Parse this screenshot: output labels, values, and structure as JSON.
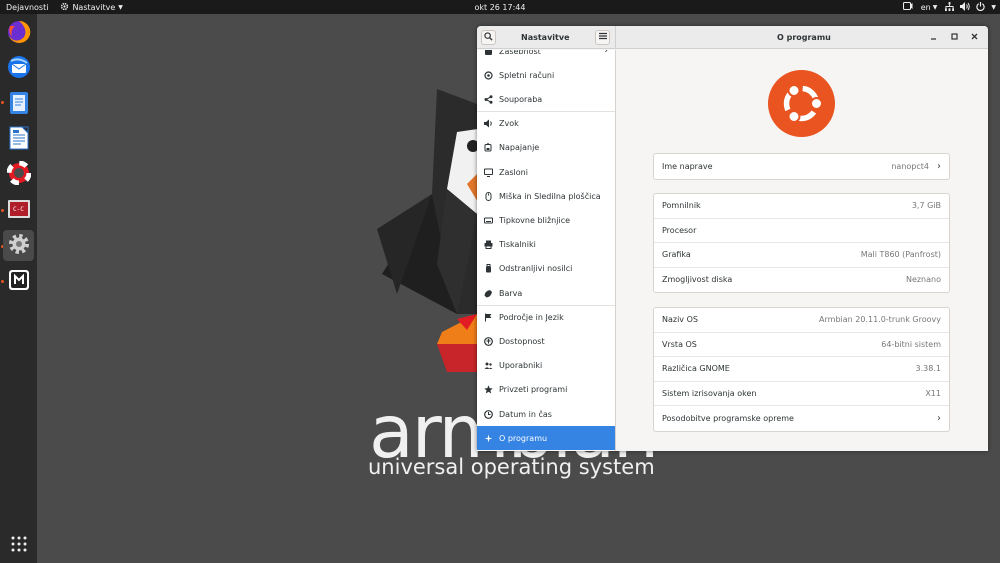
{
  "topbar": {
    "activities": "Dejavnosti",
    "app_menu": "Nastavitve",
    "clock": "okt 26  17:44",
    "keyboard_layout": "en"
  },
  "dock": {
    "apps": [
      {
        "icon": "firefox-icon",
        "running": false,
        "active": false
      },
      {
        "icon": "thunderbird-icon",
        "running": false,
        "active": false
      },
      {
        "icon": "text-editor-icon",
        "running": true,
        "active": false
      },
      {
        "icon": "libreoffice-writer-icon",
        "running": false,
        "active": false
      },
      {
        "icon": "help-icon",
        "running": false,
        "active": false
      },
      {
        "icon": "terminal-icon",
        "running": true,
        "active": false
      },
      {
        "icon": "settings-icon",
        "running": true,
        "active": true
      },
      {
        "icon": "mutt-icon",
        "running": true,
        "active": false
      }
    ],
    "show_apps_icon": "app-grid-icon"
  },
  "wallpaper": {
    "brand": "armbian",
    "tagline": "universal operating system"
  },
  "window": {
    "sidebar_title": "Nastavitve",
    "content_title": "O programu",
    "sidebar_items": [
      {
        "label": "Zasebnost",
        "icon": "privacy-icon",
        "arrow": true
      },
      {
        "label": "Spletni računi",
        "icon": "at-icon"
      },
      {
        "label": "Souporaba",
        "icon": "share-icon"
      },
      {
        "label": "Zvok",
        "icon": "speaker-icon"
      },
      {
        "label": "Napajanje",
        "icon": "battery-icon"
      },
      {
        "label": "Zasloni",
        "icon": "display-icon"
      },
      {
        "label": "Miška in Sledilna ploščica",
        "icon": "mouse-icon"
      },
      {
        "label": "Tipkovne bližnjice",
        "icon": "keyboard-icon"
      },
      {
        "label": "Tiskalniki",
        "icon": "printer-icon"
      },
      {
        "label": "Odstranljivi nosilci",
        "icon": "usb-icon"
      },
      {
        "label": "Barva",
        "icon": "color-icon"
      },
      {
        "label": "Področje in Jezik",
        "icon": "flag-icon"
      },
      {
        "label": "Dostopnost",
        "icon": "accessibility-icon"
      },
      {
        "label": "Uporabniki",
        "icon": "users-icon"
      },
      {
        "label": "Privzeti programi",
        "icon": "star-icon"
      },
      {
        "label": "Datum in čas",
        "icon": "clock-icon"
      },
      {
        "label": "O programu",
        "icon": "info-icon",
        "selected": true
      }
    ],
    "device_card": [
      {
        "label": "Ime naprave",
        "value": "nanopct4",
        "chevron": true
      }
    ],
    "hardware_card": [
      {
        "label": "Pomnilnik",
        "value": "3,7 GiB"
      },
      {
        "label": "Procesor",
        "value": ""
      },
      {
        "label": "Grafika",
        "value": "Mali T860 (Panfrost)"
      },
      {
        "label": "Zmogljivost diska",
        "value": "Neznano"
      }
    ],
    "os_card": [
      {
        "label": "Naziv OS",
        "value": "Armbian 20.11.0-trunk Groovy"
      },
      {
        "label": "Vrsta OS",
        "value": "64-bitni sistem"
      },
      {
        "label": "Različica GNOME",
        "value": "3.38.1"
      },
      {
        "label": "Sistem izrisovanja oken",
        "value": "X11"
      },
      {
        "label": "Posodobitve programske opreme",
        "value": "",
        "chevron": true
      }
    ],
    "colors": {
      "accent": "#3584e4",
      "ubuntu_orange": "#e95420"
    }
  }
}
